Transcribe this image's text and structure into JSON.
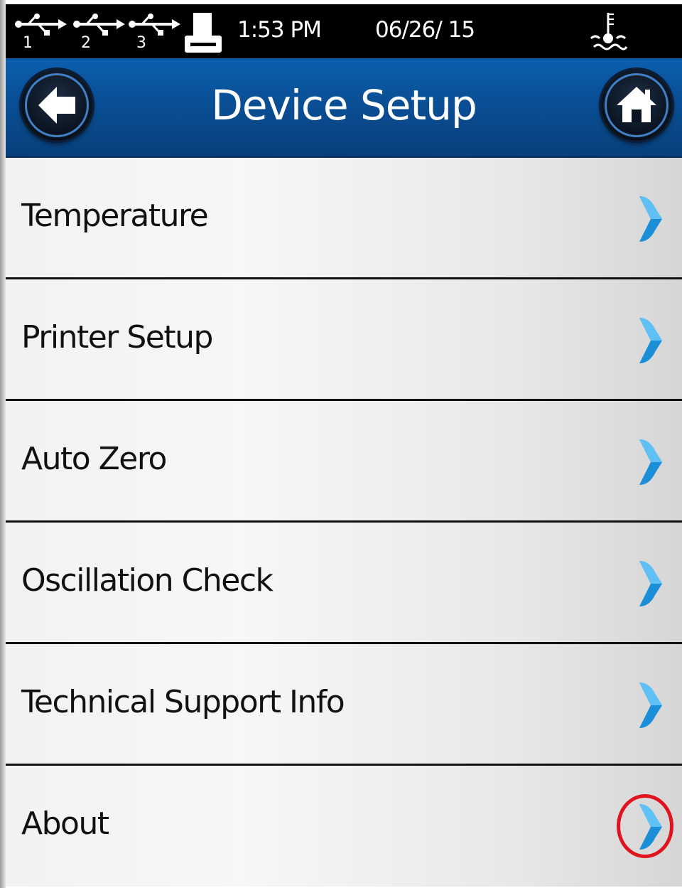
{
  "status_bar": {
    "usb_ports": [
      {
        "icon": "usb-icon",
        "number": "1"
      },
      {
        "icon": "usb-icon",
        "number": "2"
      },
      {
        "icon": "usb-icon",
        "number": "3"
      }
    ],
    "printer_icon": "printer-icon",
    "time": "1:53 PM",
    "date": "06/26/ 15",
    "temperature_icon": "thermometer-bath-icon"
  },
  "header": {
    "title": "Device Setup",
    "back_icon": "back-arrow-icon",
    "home_icon": "home-icon"
  },
  "menu": {
    "items": [
      {
        "label": "Temperature",
        "icon": "chevron-right-icon"
      },
      {
        "label": "Printer Setup",
        "icon": "chevron-right-icon"
      },
      {
        "label": "Auto Zero",
        "icon": "chevron-right-icon"
      },
      {
        "label": "Oscillation Check",
        "icon": "chevron-right-icon"
      },
      {
        "label": "Technical Support Info",
        "icon": "chevron-right-icon"
      },
      {
        "label": "About",
        "icon": "chevron-right-icon",
        "highlighted": true
      }
    ]
  },
  "colors": {
    "status_bar_bg": "#000000",
    "header_bg": "#0a4f95",
    "chevron": "#1a8fd8",
    "highlight_circle": "#e0141e",
    "menu_text": "#111111"
  }
}
